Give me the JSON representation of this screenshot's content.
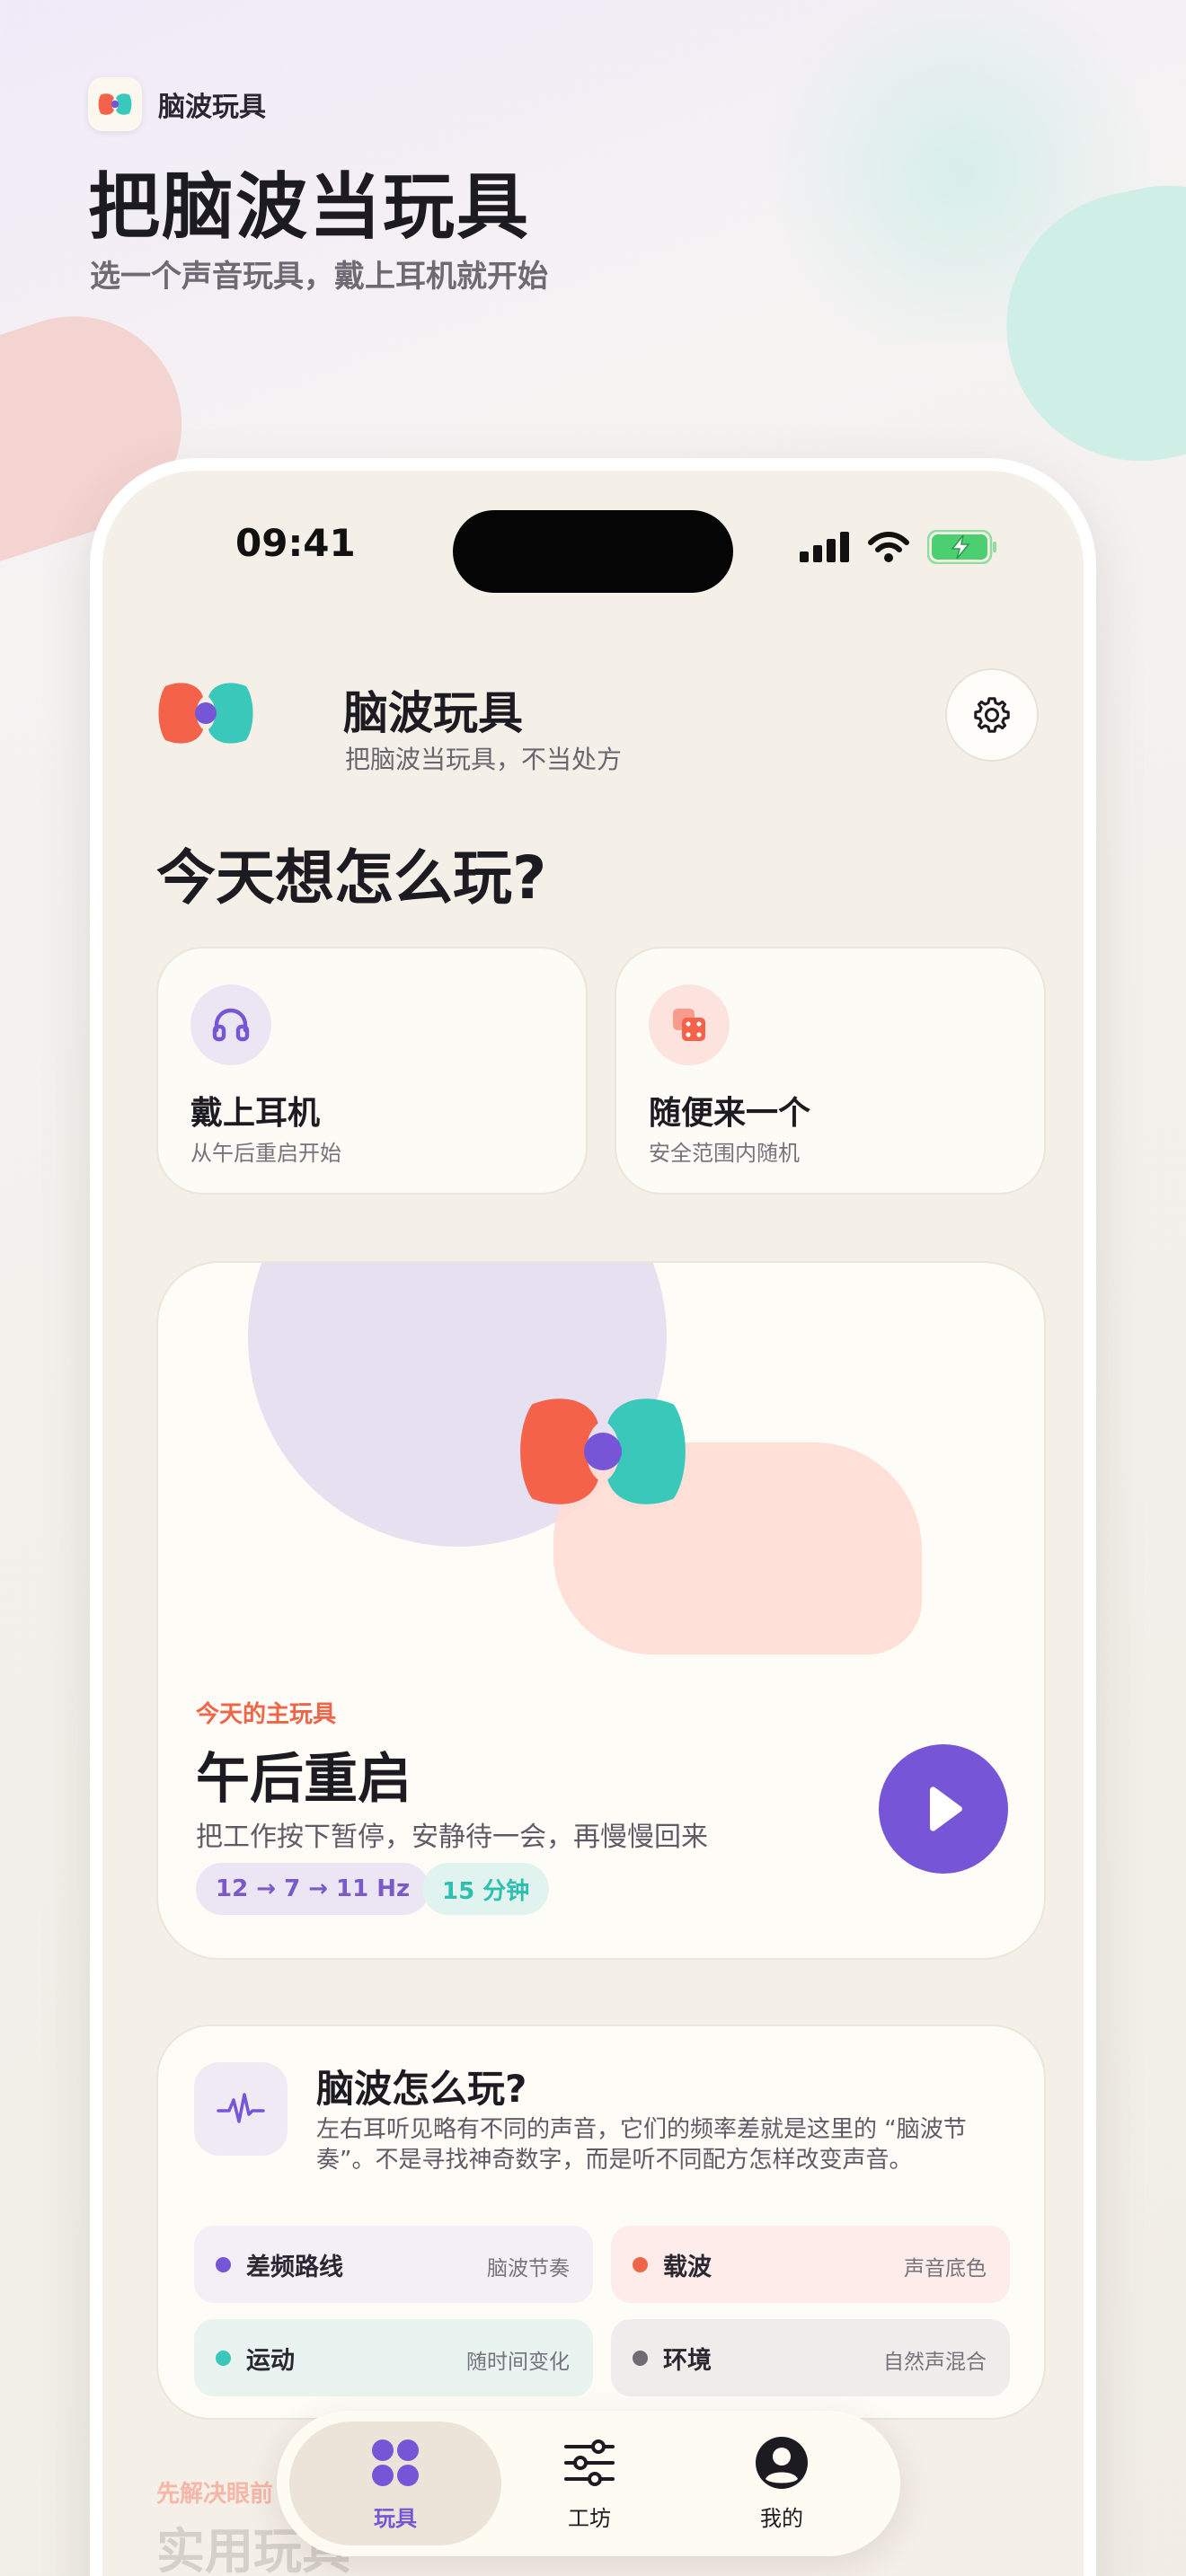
{
  "marketing": {
    "app_name": "脑波玩具",
    "title": "把脑波当玩具",
    "subtitle": "选一个声音玩具，戴上耳机就开始"
  },
  "status_bar": {
    "time": "09:41"
  },
  "header": {
    "app_name": "脑波玩具",
    "tagline": "把脑波当玩具，不当处方"
  },
  "today_heading": "今天想怎么玩?",
  "quick_actions": [
    {
      "title": "戴上耳机",
      "subtitle": "从午后重启开始",
      "icon": "headphones-icon"
    },
    {
      "title": "随便来一个",
      "subtitle": "安全范围内随机",
      "icon": "dice-icon"
    }
  ],
  "featured": {
    "kicker": "今天的主玩具",
    "title": "午后重启",
    "description": "把工作按下暂停，安静待一会，再慢慢回来",
    "chips": [
      "12 → 7 → 11 Hz",
      "15 分钟"
    ]
  },
  "explainer": {
    "title": "脑波怎么玩?",
    "description": "左右耳听见略有不同的声音，它们的频率差就是这里的 “脑波节奏”。不是寻找神奇数字，而是听不同配方怎样改变声音。",
    "tiles": [
      {
        "label": "差频路线",
        "note": "脑波节奏",
        "dot": "#7656d6"
      },
      {
        "label": "载波",
        "note": "声音底色",
        "dot": "#f06448"
      },
      {
        "label": "运动",
        "note": "随时间变化",
        "dot": "#3ac8bb"
      },
      {
        "label": "环境",
        "note": "自然声混合",
        "dot": "#6e6b72"
      }
    ]
  },
  "next_section": {
    "kicker": "先解决眼前",
    "title": "实用玩具"
  },
  "tabbar": {
    "tabs": [
      {
        "label": "玩具",
        "icon": "grid-icon",
        "active": true
      },
      {
        "label": "工坊",
        "icon": "sliders-icon",
        "active": false
      },
      {
        "label": "我的",
        "icon": "profile-icon",
        "active": false
      }
    ]
  },
  "colors": {
    "accent": "#7656d6",
    "coral": "#f06448",
    "teal": "#3ac8bb",
    "background": "#f4efe7"
  }
}
